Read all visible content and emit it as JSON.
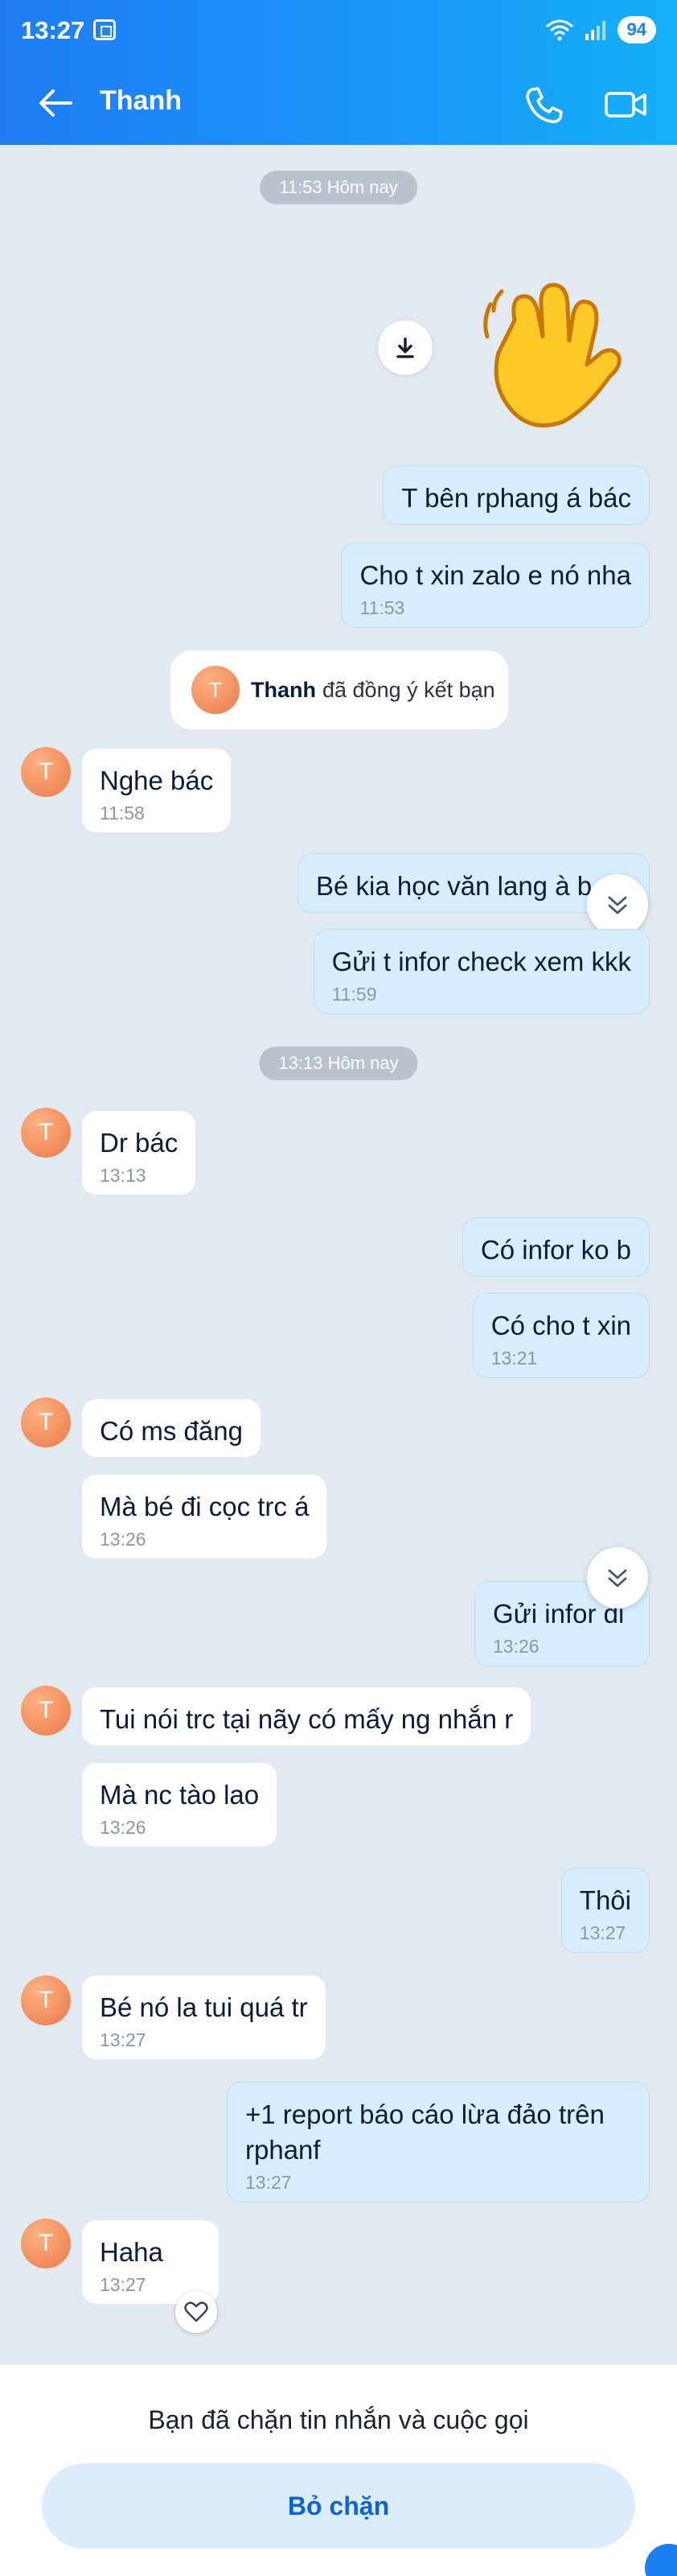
{
  "status_bar": {
    "time": "13:27",
    "battery": "94",
    "signal": "wifi-and-cellular"
  },
  "header": {
    "contact_name": "Thanh"
  },
  "chat": {
    "time_chips": [
      "11:53 Hôm nay",
      "13:13 Hôm nay"
    ],
    "friend_notice": {
      "avatar_letter": "T",
      "name": "Thanh",
      "text": "đã đồng ý kết bạn"
    },
    "avatar_letter": "T",
    "messages": [
      {
        "dir": "out",
        "text": "T bên rphang á bác",
        "time": ""
      },
      {
        "dir": "out",
        "text": "Cho t xin zalo e nó nha",
        "time": "11:53"
      },
      {
        "dir": "in",
        "text": "Nghe bác",
        "time": "11:58"
      },
      {
        "dir": "out",
        "text": "Bé kia học văn lang à b",
        "time": ""
      },
      {
        "dir": "out",
        "text": "Gửi t infor check xem kkk",
        "time": "11:59"
      },
      {
        "dir": "in",
        "text": "Dr bác",
        "time": "13:13"
      },
      {
        "dir": "out",
        "text": "Có infor ko b",
        "time": ""
      },
      {
        "dir": "out",
        "text": "Có cho t xin",
        "time": "13:21"
      },
      {
        "dir": "in",
        "text": "Có ms đăng",
        "time": ""
      },
      {
        "dir": "in",
        "text": "Mà bé đi cọc trc á",
        "time": "13:26"
      },
      {
        "dir": "out",
        "text": "Gửi infor đi",
        "time": "13:26"
      },
      {
        "dir": "in",
        "text": "Tui nói trc tại nãy có mấy ng nhắn r",
        "time": ""
      },
      {
        "dir": "in",
        "text": "Mà nc tào lao",
        "time": "13:26"
      },
      {
        "dir": "out",
        "text": "Thôi",
        "time": "13:27"
      },
      {
        "dir": "in",
        "text": "Bé nó la tui quá tr",
        "time": "13:27"
      },
      {
        "dir": "out",
        "text": "+1 report báo cáo lừa đảo trên rphanf",
        "time": "13:27"
      },
      {
        "dir": "in",
        "text": "Haha",
        "time": "13:27"
      }
    ]
  },
  "bottom": {
    "blocked_text": "Bạn đã chặn tin nhắn và cuộc gọi",
    "unblock_label": "Bỏ chặn"
  },
  "colors": {
    "header_start": "#1f7cf5",
    "header_end": "#14b0f7",
    "outgoing_bubble": "#d6eefe",
    "background": "#e2e9f1",
    "accent": "#0b64d6"
  }
}
